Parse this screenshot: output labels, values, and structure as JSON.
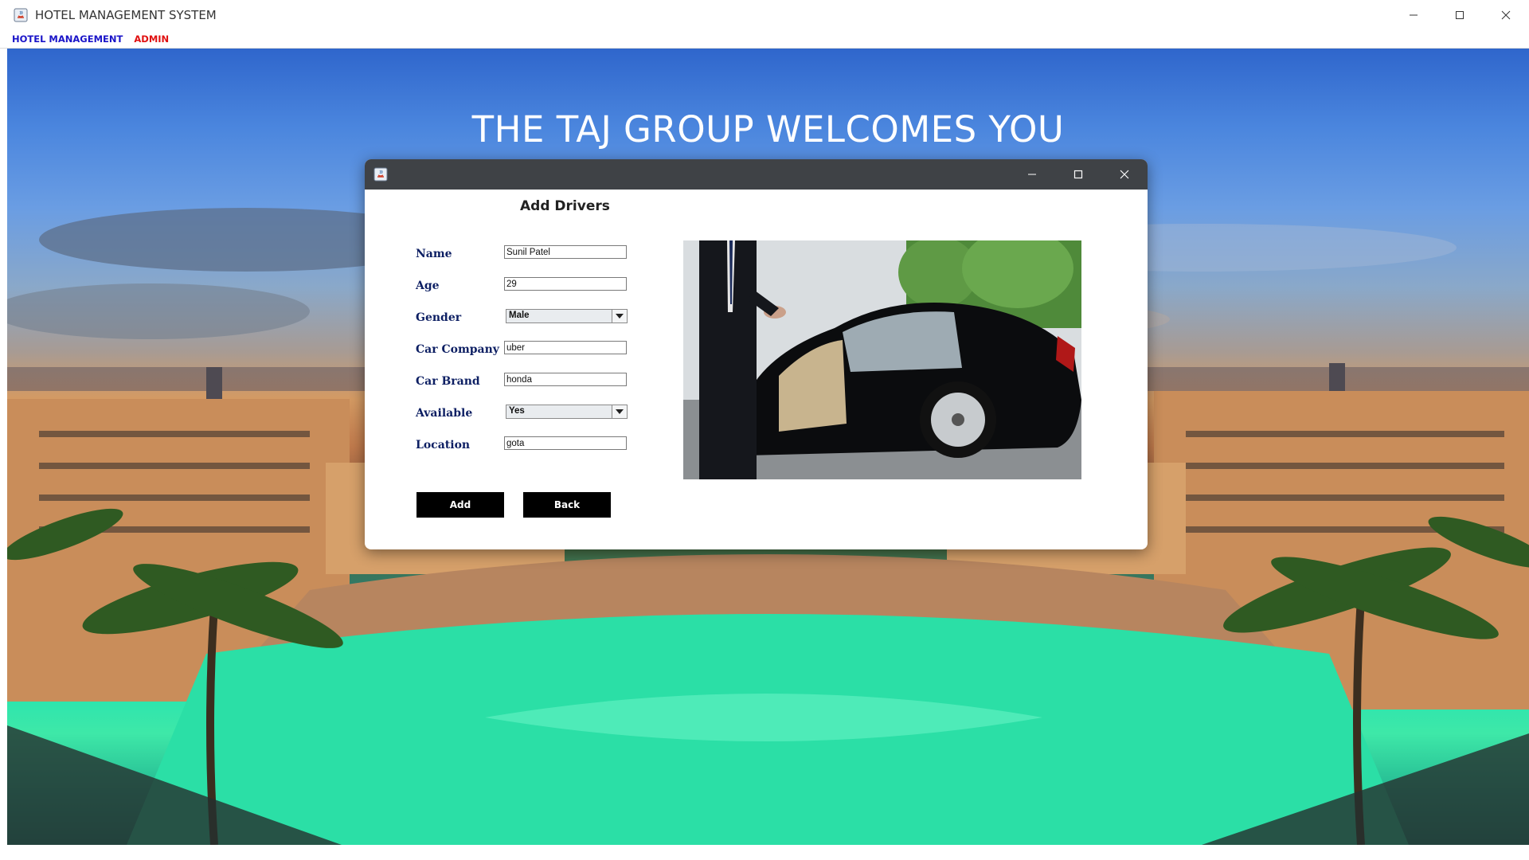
{
  "window": {
    "title": "HOTEL MANAGEMENT SYSTEM",
    "controls": [
      "minimize-icon",
      "maximize-icon",
      "close-icon"
    ]
  },
  "menubar": {
    "items": [
      {
        "label": "HOTEL MANAGEMENT",
        "color": "#1a14c8"
      },
      {
        "label": "ADMIN",
        "color": "#e01010"
      }
    ]
  },
  "background": {
    "welcome_text": "THE TAJ GROUP WELCOMES YOU"
  },
  "dialog": {
    "heading": "Add Drivers",
    "fields": {
      "name": {
        "label": "Name",
        "value": "Sunil Patel"
      },
      "age": {
        "label": "Age",
        "value": "29"
      },
      "gender": {
        "label": "Gender",
        "value": "Male"
      },
      "car_company": {
        "label": "Car Company",
        "value": "uber"
      },
      "car_brand": {
        "label": "Car Brand",
        "value": "honda"
      },
      "available": {
        "label": "Available",
        "value": "Yes"
      },
      "location": {
        "label": "Location",
        "value": "gota"
      }
    },
    "buttons": {
      "add": "Add",
      "back": "Back"
    }
  }
}
